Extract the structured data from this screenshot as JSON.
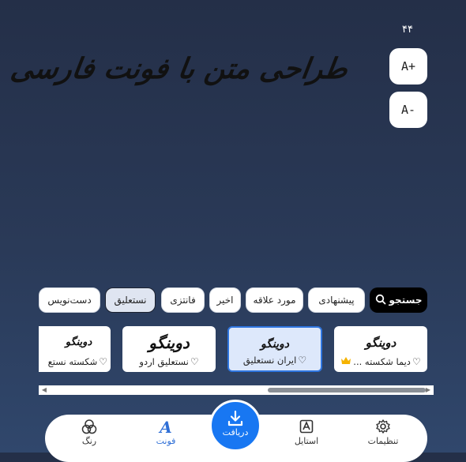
{
  "font_size": {
    "value": "۴۴",
    "increase_label": "A+",
    "decrease_label": "A-"
  },
  "canvas": {
    "text": "طراحی متن با فونت فارسی"
  },
  "filters": {
    "search_label": "جستجو",
    "chips": [
      "پیشنهادی",
      "مورد علاقه",
      "اخیر",
      "فانتزی",
      "نستعلیق",
      "دست‌نویس"
    ],
    "selected": "نستعلیق"
  },
  "fonts": [
    {
      "name": "دیما شکسته ...",
      "preview": "دوینگو",
      "premium": true
    },
    {
      "name": "ایران نستعلیق",
      "preview": "دوینگو",
      "selected": true
    },
    {
      "name": "نستعلیق اردو",
      "preview": "دوینگو"
    },
    {
      "name": "شکسته نستع",
      "preview": "دوینگو"
    }
  ],
  "bottom_nav": {
    "settings": "تنظیمات",
    "style": "استایل",
    "download": "دریافت",
    "font": "فونت",
    "color": "رنگ"
  },
  "colors": {
    "accent": "#1877f2",
    "selected_card_border": "#2f76e0",
    "premium": "#f5b301"
  }
}
